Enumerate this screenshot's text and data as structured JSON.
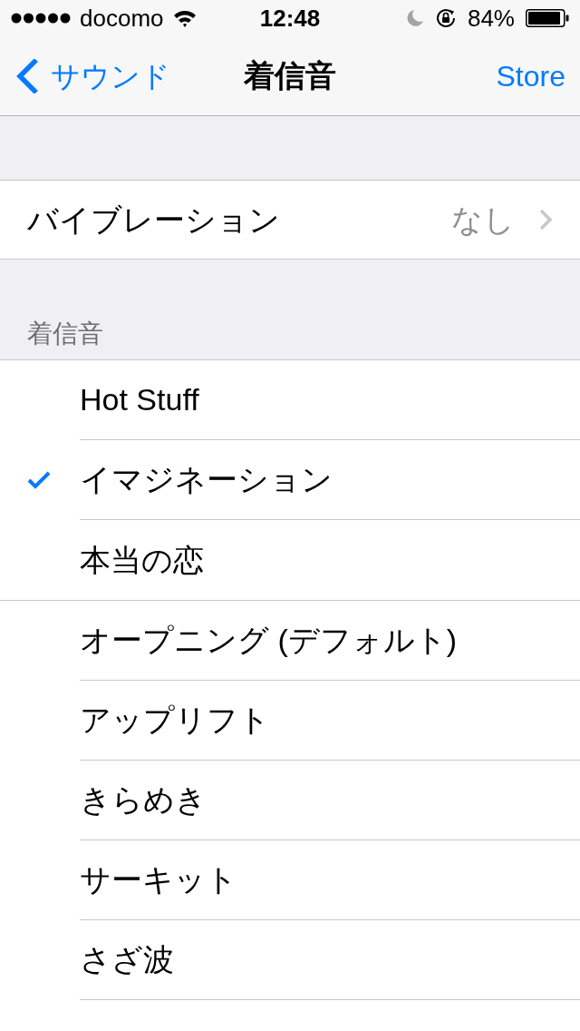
{
  "status_bar": {
    "carrier": "docomo",
    "time": "12:48",
    "battery": "84%"
  },
  "nav_bar": {
    "back": "サウンド",
    "title": "着信音",
    "action": "Store"
  },
  "vibration": {
    "label": "バイブレーション",
    "value": "なし"
  },
  "ringtones": {
    "header": "着信音",
    "groups": [
      {
        "items": [
          {
            "name": "Hot Stuff",
            "selected": false
          },
          {
            "name": "イマジネーション",
            "selected": true
          },
          {
            "name": "本当の恋",
            "selected": false
          }
        ]
      },
      {
        "items": [
          {
            "name": "オープニング (デフォルト)",
            "selected": false
          },
          {
            "name": "アップリフト",
            "selected": false
          },
          {
            "name": "きらめき",
            "selected": false
          },
          {
            "name": "サーキット",
            "selected": false
          },
          {
            "name": "さざ波",
            "selected": false
          }
        ]
      }
    ]
  }
}
